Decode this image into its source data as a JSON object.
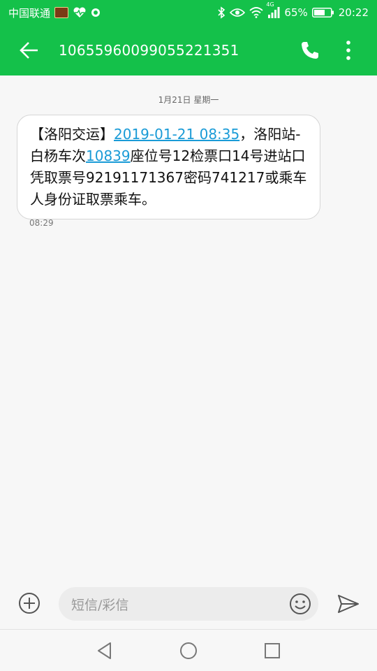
{
  "status_bar": {
    "carrier": "中国联通",
    "battery": "65%",
    "time": "20:22",
    "network": "4G"
  },
  "header": {
    "contact": "10655960099055221351",
    "back_icon": "arrow-left-icon",
    "call_icon": "phone-icon",
    "more_icon": "more-vertical-icon"
  },
  "conversation": {
    "date": "1月21日 星期一",
    "message": {
      "part1": "【洛阳交运】",
      "link_datetime": "2019-01-21 08:35",
      "part2": "，洛阳站-白杨车次",
      "link_train": "10839",
      "part3": "座位号12检票口14号进站口凭取票号92191171367密码741217或乘车人身份证取票乘车。",
      "time": "08:29"
    }
  },
  "composer": {
    "placeholder": "短信/彩信",
    "add_icon": "plus-circle-icon",
    "emoji_icon": "smiley-icon",
    "send_icon": "send-icon"
  },
  "colors": {
    "accent": "#14c14a",
    "link": "#1a9bd7"
  }
}
